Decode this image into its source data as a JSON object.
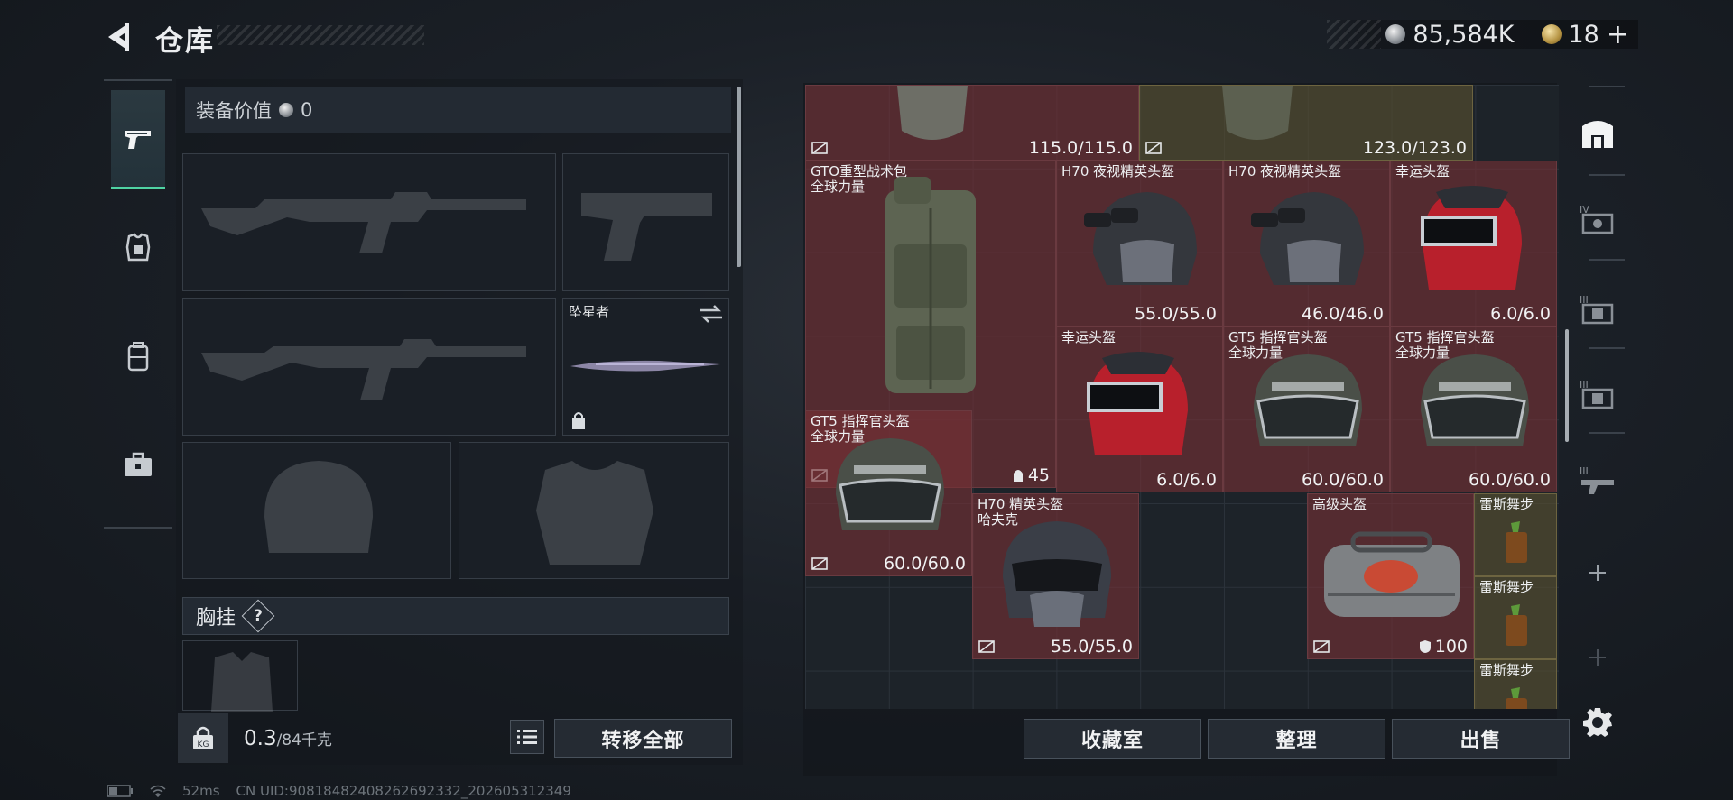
{
  "header": {
    "title": "仓库",
    "silver_amount": "85,584K",
    "gold_amount": "18",
    "gold_plus": "+"
  },
  "left_panel": {
    "equip_value_label": "装备价值",
    "equip_value": "0",
    "melee_name": "坠星者",
    "chest_rig_label": "胸挂",
    "help": "?",
    "weight_current": "0.3",
    "weight_max": "/84千克",
    "transfer_all": "转移全部"
  },
  "grid_items": [
    {
      "name": "",
      "sub": "",
      "durability": "115.0/115.0"
    },
    {
      "name": "",
      "sub": "",
      "durability": "123.0/123.0"
    },
    {
      "name": "GTO重型战术包",
      "sub": "全球力量",
      "count": "45"
    },
    {
      "name": "H70 夜视精英头盔",
      "sub": "",
      "durability": "55.0/55.0"
    },
    {
      "name": "H70 夜视精英头盔",
      "sub": "",
      "durability": "46.0/46.0"
    },
    {
      "name": "幸运头盔",
      "sub": "",
      "durability": "6.0/6.0"
    },
    {
      "name": "幸运头盔",
      "sub": "",
      "durability": "6.0/6.0"
    },
    {
      "name": "GT5 指挥官头盔",
      "sub": "全球力量",
      "durability": "60.0/60.0"
    },
    {
      "name": "GT5 指挥官头盔",
      "sub": "全球力量",
      "durability": "60.0/60.0"
    },
    {
      "name": "GT5 指挥官头盔",
      "sub": "全球力量",
      "durability": "60.0/60.0"
    },
    {
      "name": "H70 精英头盔",
      "sub": "哈夫克",
      "durability": "55.0/55.0"
    },
    {
      "name": "高级头盔",
      "sub": "",
      "count": "100"
    },
    {
      "name": "雷斯舞步",
      "sub": ""
    },
    {
      "name": "雷斯舞步",
      "sub": ""
    },
    {
      "name": "雷斯舞步",
      "sub": ""
    }
  ],
  "bottom_buttons": {
    "collection": "收藏室",
    "organize": "整理",
    "sell": "出售"
  },
  "footer": {
    "ping": "52ms",
    "uid": "CN UID:9081848240826269233​2_202605312349"
  },
  "colors": {
    "item_red": "#763036",
    "accent_green": "#4fd3a3",
    "grid_bg": "#1d2329"
  },
  "icons": {
    "back": "back-chevron-icon",
    "silver": "silver-coin-icon",
    "gold": "gold-coin-icon",
    "weapon_tab": "pistol-icon",
    "armor_tab": "armor-icon",
    "backpack_tab": "backpack-icon",
    "case_tab": "briefcase-icon",
    "settings": "gear-icon"
  }
}
